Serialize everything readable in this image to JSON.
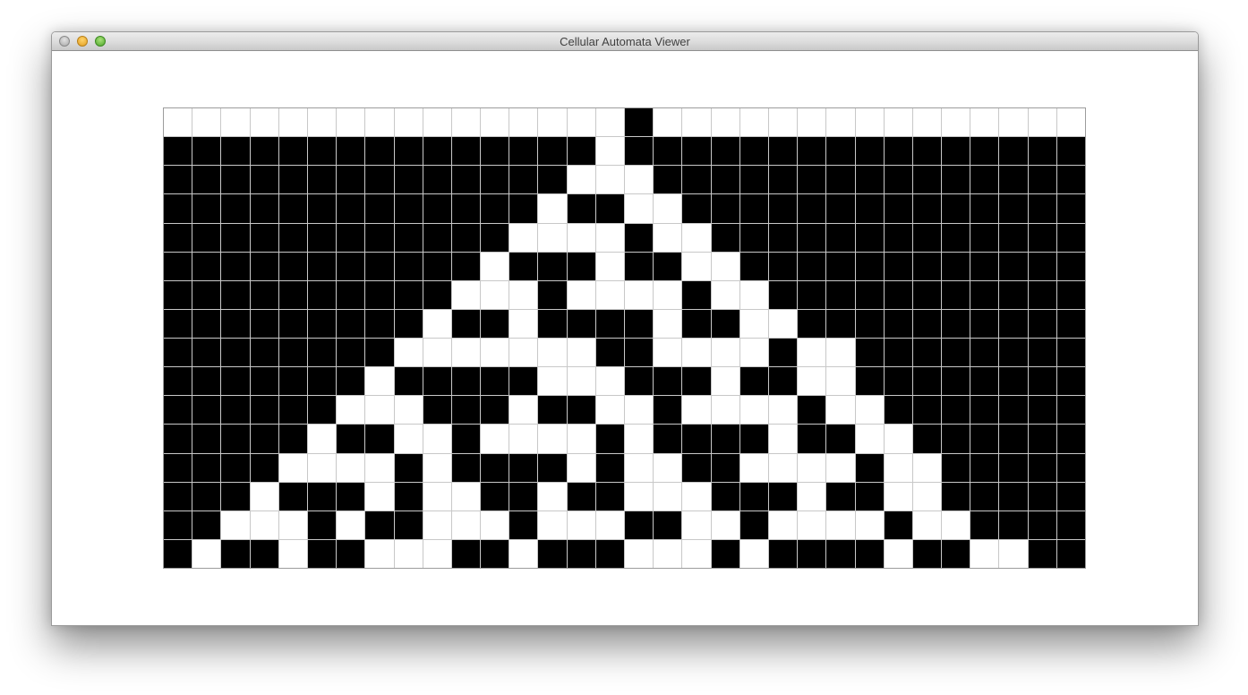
{
  "window": {
    "title": "Cellular Automata Viewer"
  },
  "grid": {
    "columns": 32,
    "rows": [
      "................O...............",
      "OOOOOOOOOOOOOOO.OOOOOOOOOOOOOOOO",
      "OOOOOOOOOOOOOO...OOOOOOOOOOOOOOO",
      "OOOOOOOOOOOOO.OO..OOOOOOOOOOOOOO",
      "OOOOOOOOOOOO....O..OOOOOOOOOOOOO",
      "OOOOOOOOOOO.OOO.OO..OOOOOOOOOOOO",
      "OOOOOOOOOO...O....O..OOOOOOOOOOO",
      "OOOOOOOOO.OO.OOOO.OO..OOOOOOOOOO",
      "OOOOOOOO.......OO....O..OOOOOOOO",
      "OOOOOOO.OOOOO...OOO.OO..OOOOOOOO",
      "OOOOOO...OOO.OO..O....O..OOOOOOO",
      "OOOOO.OO..O....O.OOOO.OO..OOOOOO",
      "OOOO....O.OOOO.O..OO....O..OOOOO",
      "OOO.OOO.O..OO.OO...OOO.OO..OOOOO",
      "OO...O.OO...O...OO..O....O..OOOO",
      "O.OO.OO...OO.OOO...O.OOOO.OO..OO"
    ],
    "colors": {
      "alive": "#000000",
      "dead": "#ffffff",
      "gridline": "#c8c8c8"
    }
  }
}
